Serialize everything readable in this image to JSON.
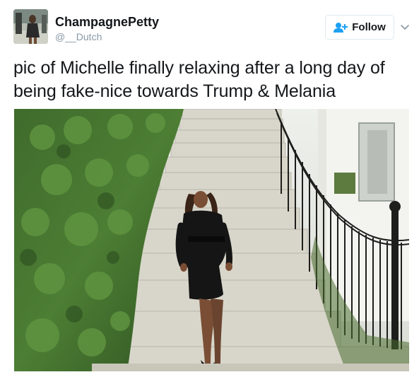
{
  "tweet": {
    "author": {
      "display_name": "ChampagnePetty",
      "screen_name": "@__Dutch",
      "avatar_icon": "user-avatar"
    },
    "follow_button": {
      "label": "Follow",
      "icon": "add-user-icon",
      "accent_color": "#1da1f2"
    },
    "more_menu_icon": "chevron-down-icon",
    "text": "pic of Michelle finally relaxing after a long day of being fake-nice towards Trump & Melania",
    "media": {
      "type": "photo",
      "subject": "woman in black dress reclining on white marble staircase beside hedge and iron railing"
    }
  },
  "colors": {
    "text_primary": "#14171a",
    "text_secondary": "#8899a6",
    "border": "#e1e8ed",
    "accent": "#1da1f2"
  }
}
